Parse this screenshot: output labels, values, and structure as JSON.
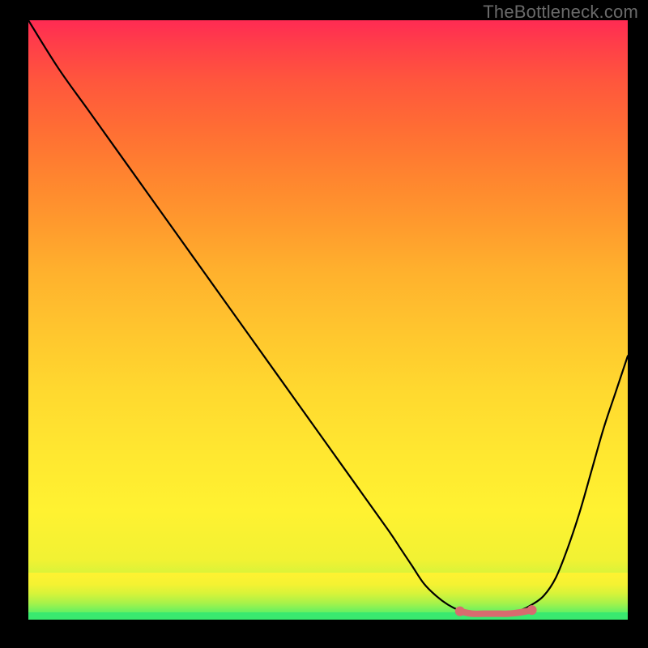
{
  "watermark": "TheBottleneck.com",
  "chart_data": {
    "type": "line",
    "title": "",
    "xlabel": "",
    "ylabel": "",
    "xlim": [
      0,
      100
    ],
    "ylim": [
      0,
      100
    ],
    "grid": false,
    "legend": false,
    "background_gradient": {
      "top_color": "#ff2b53",
      "bottom_color": "#39e96f",
      "direction": "vertical"
    },
    "series": [
      {
        "name": "bottleneck-curve",
        "stroke": "#000000",
        "x": [
          0,
          5,
          10,
          15,
          20,
          25,
          30,
          35,
          40,
          45,
          50,
          55,
          60,
          62,
          64,
          66,
          68,
          70,
          72,
          74,
          76,
          78,
          80,
          82,
          84,
          86,
          88,
          90,
          92,
          94,
          96,
          98,
          100
        ],
        "y": [
          100,
          92,
          85,
          78,
          71,
          64,
          57,
          50,
          43,
          36,
          29,
          22,
          15,
          12,
          9,
          6,
          4,
          2.5,
          1.5,
          1,
          1,
          1,
          1,
          1.5,
          2.5,
          4,
          7,
          12,
          18,
          25,
          32,
          38,
          44
        ]
      },
      {
        "name": "flat-highlight",
        "stroke": "#d86b6f",
        "stroke_width": 8,
        "x": [
          72,
          74,
          76,
          78,
          80,
          82,
          84
        ],
        "y": [
          1.4,
          1.0,
          1.0,
          1.0,
          1.0,
          1.2,
          1.6
        ],
        "endpoints": true
      }
    ],
    "annotations": []
  }
}
